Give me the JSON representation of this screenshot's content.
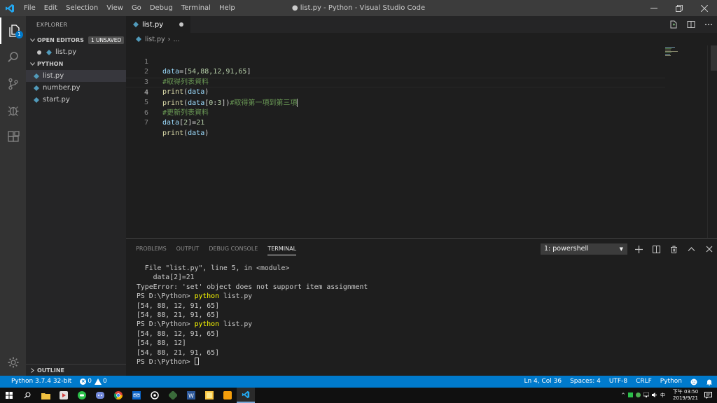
{
  "window": {
    "title": "● list.py - Python - Visual Studio Code",
    "menu": [
      "File",
      "Edit",
      "Selection",
      "View",
      "Go",
      "Debug",
      "Terminal",
      "Help"
    ]
  },
  "activity": {
    "explorer_badge": "1"
  },
  "sidebar": {
    "title": "EXPLORER",
    "open_editors": {
      "label": "OPEN EDITORS",
      "badge": "1 UNSAVED",
      "files": [
        "list.py"
      ]
    },
    "folder": {
      "label": "PYTHON",
      "files": [
        "list.py",
        "number.py",
        "start.py"
      ]
    },
    "outline": "OUTLINE"
  },
  "editor": {
    "tab": "list.py",
    "breadcrumb": {
      "file": "list.py",
      "rest": "..."
    },
    "lines": [
      {
        "n": "1",
        "text": "data=[54,88,12,91,65]"
      },
      {
        "n": "2",
        "text": "#取得列表資料"
      },
      {
        "n": "3",
        "text": "print(data)"
      },
      {
        "n": "4",
        "text": "print(data[0:3])#取得第一項到第三項"
      },
      {
        "n": "5",
        "text": "#更新列表資料"
      },
      {
        "n": "6",
        "text": "data[2]=21"
      },
      {
        "n": "7",
        "text": "print(data)"
      }
    ],
    "code": {
      "l1_var": "data",
      "l1_rest": "=[",
      "l1_nums": "54,88,12,91,65",
      "l1_end": "]",
      "l2_cmt": "#取得列表資料",
      "l3_fn": "print",
      "l3_open": "(",
      "l3_var": "data",
      "l3_close": ")",
      "l4_fn": "print",
      "l4_open": "(",
      "l4_var": "data",
      "l4_br": "[",
      "l4_n0": "0",
      "l4_colon": ":",
      "l4_n3": "3",
      "l4_close": "])",
      "l4_cmt": "#取得第一項到第三項",
      "l5_cmt": "#更新列表資料",
      "l6_var": "data",
      "l6_br": "[",
      "l6_n2": "2",
      "l6_mid": "]=",
      "l6_n21": "21",
      "l7_fn": "print",
      "l7_open": "(",
      "l7_var": "data",
      "l7_close": ")"
    }
  },
  "panel": {
    "tabs": [
      "PROBLEMS",
      "OUTPUT",
      "DEBUG CONSOLE",
      "TERMINAL"
    ],
    "active_tab": "TERMINAL",
    "terminal_select": "1: powershell",
    "terminal": {
      "l1": "  File \"list.py\", line 5, in <module>",
      "l2": "    data[2]=21",
      "l3": "TypeError: 'set' object does not support item assignment",
      "l4_prompt": "PS D:\\Python> ",
      "l4_cmd": "python",
      "l4_arg": " list.py",
      "l5": "[54, 88, 12, 91, 65]",
      "l6": "[54, 88, 21, 91, 65]",
      "l7_prompt": "PS D:\\Python> ",
      "l7_cmd": "python",
      "l7_arg": " list.py",
      "l8": "[54, 88, 12, 91, 65]",
      "l9": "[54, 88, 12]",
      "l10": "[54, 88, 21, 91, 65]",
      "l11_prompt": "PS D:\\Python> "
    }
  },
  "status": {
    "interpreter": "Python 3.7.4 32-bit",
    "errors": "0",
    "warnings": "0",
    "position": "Ln 4, Col 36",
    "spaces": "Spaces: 4",
    "encoding": "UTF-8",
    "eol": "CRLF",
    "language": "Python"
  },
  "taskbar": {
    "time": "下午 03:50",
    "date": "2019/9/21",
    "ime": "中"
  },
  "colors": {
    "accent": "#007acc",
    "python_icon": "#519aba"
  }
}
